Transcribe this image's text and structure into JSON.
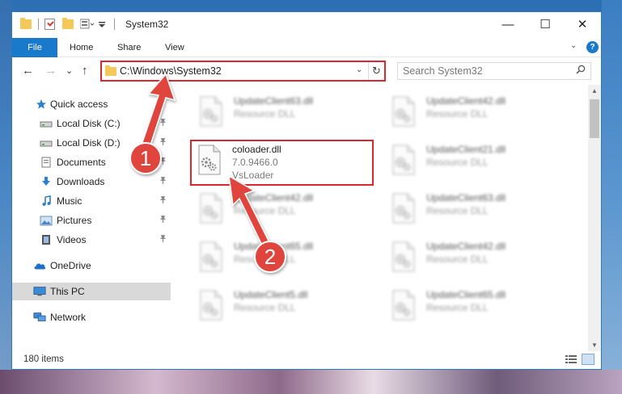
{
  "window": {
    "title": "System32",
    "controls": {
      "minimize": "—",
      "maximize": "☐",
      "close": "✕"
    }
  },
  "ribbon": {
    "tabs": [
      "File",
      "Home",
      "Share",
      "View"
    ],
    "collapse_glyph": "⌄",
    "help_glyph": "?"
  },
  "nav": {
    "back": "←",
    "forward": "→",
    "recent": "⌄",
    "up": "↑",
    "address": "C:\\Windows\\System32",
    "address_dropdown": "⌄",
    "refresh": "↻",
    "search_placeholder": "Search System32",
    "search_glyph": "⚲"
  },
  "sidebar": {
    "items": [
      {
        "label": "Quick access",
        "icon": "star-icon"
      },
      {
        "label": "Local Disk (C:)",
        "icon": "drive-icon",
        "pinned": true
      },
      {
        "label": "Local Disk (D:)",
        "icon": "drive-icon",
        "pinned": true
      },
      {
        "label": "Documents",
        "icon": "documents-icon",
        "pinned": true
      },
      {
        "label": "Downloads",
        "icon": "download-icon",
        "pinned": true
      },
      {
        "label": "Music",
        "icon": "music-icon",
        "pinned": true
      },
      {
        "label": "Pictures",
        "icon": "pictures-icon",
        "pinned": true
      },
      {
        "label": "Videos",
        "icon": "videos-icon",
        "pinned": true
      },
      {
        "label": "OneDrive",
        "icon": "onedrive-icon"
      },
      {
        "label": "This PC",
        "icon": "pc-icon",
        "selected": true
      },
      {
        "label": "Network",
        "icon": "network-icon"
      }
    ],
    "pin_glyph": "📌"
  },
  "files": [
    {
      "name": "UpdateClient63.dll",
      "line1": "Resource DLL",
      "line2": "",
      "blurred": true
    },
    {
      "name": "UpdateClient42.dll",
      "line1": "Resource DLL",
      "line2": "",
      "blurred": true
    },
    {
      "name": "coloader.dll",
      "line1": "7.0.9466.0",
      "line2": "VsLoader",
      "blurred": false,
      "highlighted": true
    },
    {
      "name": "UpdateClient21.dll",
      "line1": "Resource DLL",
      "line2": "",
      "blurred": true
    },
    {
      "name": "UpdateClient42.dll",
      "line1": "Resource DLL",
      "line2": "",
      "blurred": true
    },
    {
      "name": "UpdateClient63.dll",
      "line1": "Resource DLL",
      "line2": "",
      "blurred": true
    },
    {
      "name": "UpdateClient65.dll",
      "line1": "Resource DLL",
      "line2": "",
      "blurred": true
    },
    {
      "name": "UpdateClient42.dll",
      "line1": "Resource DLL",
      "line2": "",
      "blurred": true
    },
    {
      "name": "UpdateClient5.dll",
      "line1": "Resource DLL",
      "line2": "",
      "blurred": true
    },
    {
      "name": "UpdateClient65.dll",
      "line1": "Resource DLL",
      "line2": "",
      "blurred": true
    }
  ],
  "status": {
    "item_count": "180 items"
  },
  "annotations": [
    {
      "number": "1",
      "target": "address-bar"
    },
    {
      "number": "2",
      "target": "coloader-tile"
    }
  ],
  "colors": {
    "accent": "#1979ca",
    "highlight_red": "#d7282f",
    "arrow_red": "#e0443e",
    "selected_bg": "#d9d9d9"
  }
}
